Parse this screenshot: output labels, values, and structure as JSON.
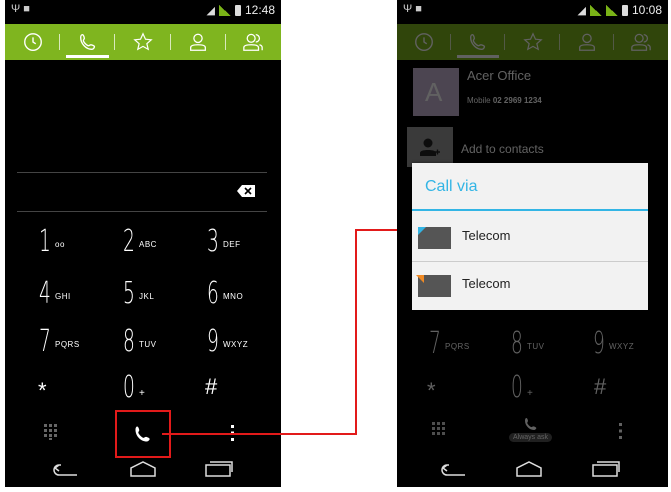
{
  "left_phone": {
    "status": {
      "time": "12:48"
    },
    "tabs": [
      {
        "name": "recent",
        "icon": "clock-icon"
      },
      {
        "name": "phone",
        "icon": "phone-icon",
        "active": true
      },
      {
        "name": "favorites",
        "icon": "star-icon"
      },
      {
        "name": "contacts",
        "icon": "person-icon"
      },
      {
        "name": "groups",
        "icon": "group-icon"
      }
    ],
    "keys": [
      {
        "digit": "1",
        "letters": "oo"
      },
      {
        "digit": "2",
        "letters": "ABC"
      },
      {
        "digit": "3",
        "letters": "DEF"
      },
      {
        "digit": "4",
        "letters": "GHI"
      },
      {
        "digit": "5",
        "letters": "JKL"
      },
      {
        "digit": "6",
        "letters": "MNO"
      },
      {
        "digit": "7",
        "letters": "PQRS"
      },
      {
        "digit": "8",
        "letters": "TUV"
      },
      {
        "digit": "9",
        "letters": "WXYZ"
      },
      {
        "digit": "*",
        "letters": ""
      },
      {
        "digit": "0",
        "letters": "+"
      },
      {
        "digit": "#",
        "letters": ""
      }
    ]
  },
  "right_phone": {
    "status": {
      "time": "10:08"
    },
    "contact": {
      "name": "Acer Office",
      "avatar_letter": "A",
      "phone_type": "Mobile",
      "phone_number": "02 2969 1234"
    },
    "add_contact_label": "Add to contacts",
    "dialog": {
      "title": "Call via",
      "options": [
        {
          "label": "Telecom",
          "accent": "#33b5e5"
        },
        {
          "label": "Telecom",
          "accent": "#f08a24"
        }
      ]
    },
    "keys": [
      {
        "digit": "7",
        "letters": "PQRS"
      },
      {
        "digit": "8",
        "letters": "TUV"
      },
      {
        "digit": "9",
        "letters": "WXYZ"
      },
      {
        "digit": "*",
        "letters": ""
      },
      {
        "digit": "0",
        "letters": "+"
      },
      {
        "digit": "#",
        "letters": ""
      }
    ],
    "always_ask_label": "Always ask"
  },
  "colors": {
    "accent_green": "#7fb51f",
    "highlight_red": "#e21a1a",
    "dialog_blue": "#33b5e5"
  }
}
